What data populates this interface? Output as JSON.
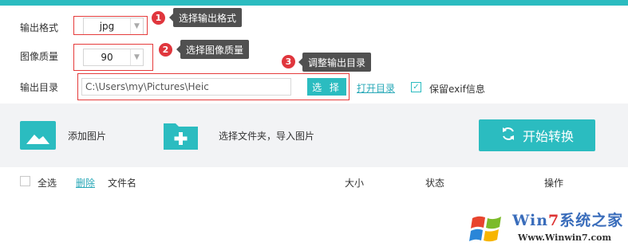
{
  "settings": {
    "format_label": "输出格式",
    "format_value": "jpg",
    "quality_label": "图像质量",
    "quality_value": "90",
    "dir_label": "输出目录",
    "dir_value": "C:\\Users\\my\\Pictures\\Heic",
    "choose_button": "选 择",
    "open_dir_link": "打开目录",
    "exif_label": "保留exif信息",
    "exif_checked": true
  },
  "annotations": [
    {
      "number": "1",
      "text": "选择输出格式"
    },
    {
      "number": "2",
      "text": "选择图像质量"
    },
    {
      "number": "3",
      "text": "调整输出目录"
    }
  ],
  "toolbar": {
    "add_image": "添加图片",
    "add_folder": "选择文件夹，导入图片",
    "start_button": "开始转换"
  },
  "list": {
    "select_all": "全选",
    "delete": "删除",
    "columns": [
      "文件名",
      "大小",
      "状态",
      "操作"
    ]
  },
  "watermark": {
    "brand_prefix": "Win",
    "brand_seven": "7",
    "brand_suffix": "系统之家",
    "url": "Www.Winwin7.com"
  },
  "colors": {
    "accent": "#2bbcc0",
    "annotation_red": "#e0363d",
    "tooltip_bg": "#505050",
    "link": "#2aa9b8"
  }
}
